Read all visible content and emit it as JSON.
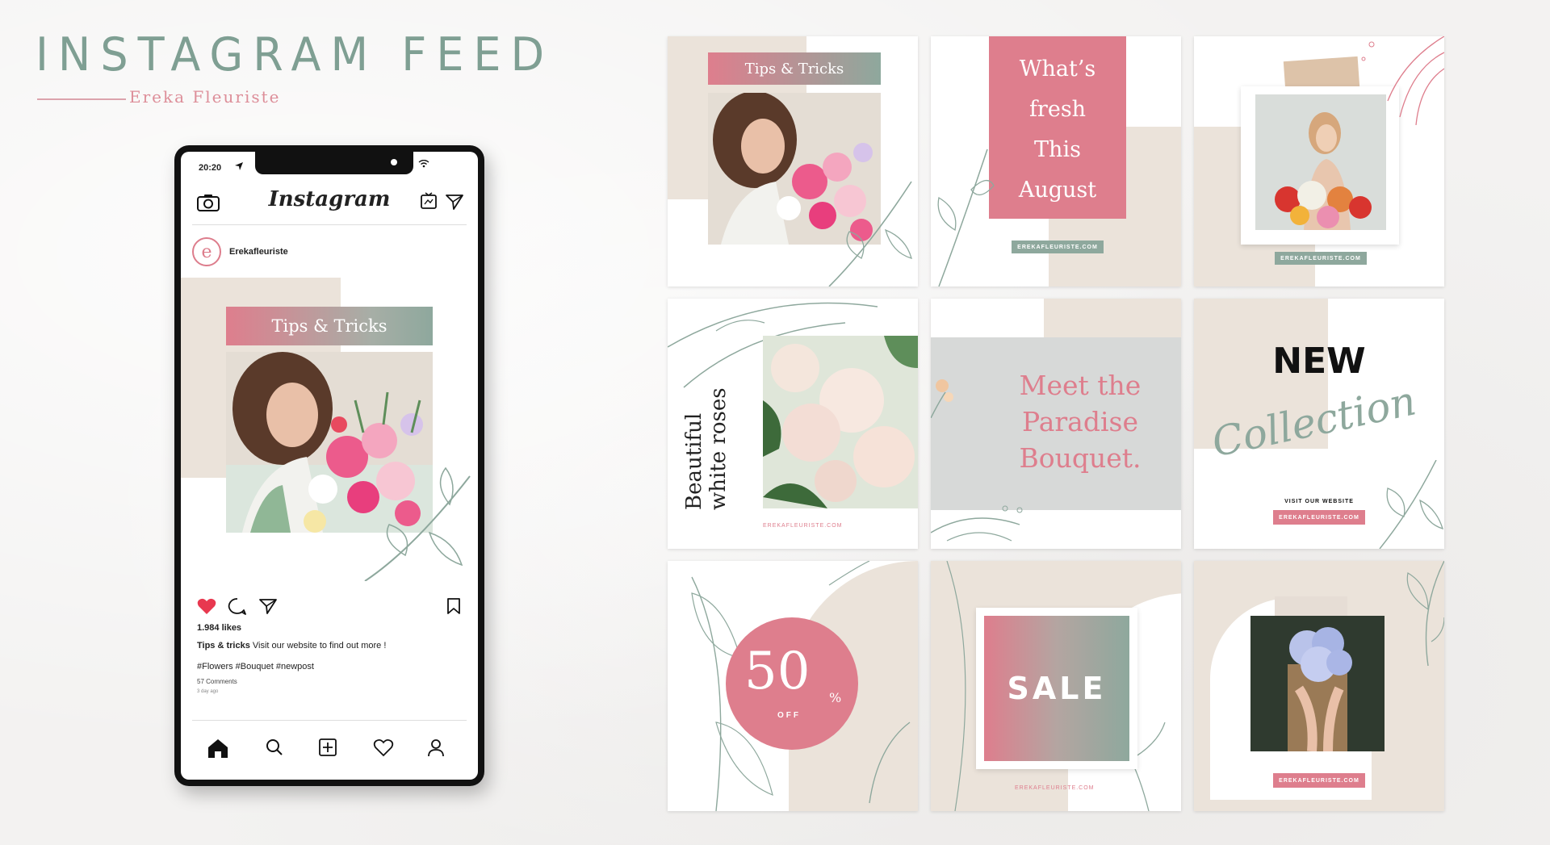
{
  "header": {
    "title": "INSTAGRAM FEED",
    "subtitle": "Ereka Fleuriste"
  },
  "phone": {
    "status_time": "20:20",
    "app_name": "Instagram",
    "username": "Erekafleuriste",
    "avatar_letter": "e",
    "post_banner": "Tips & Tricks",
    "likes": "1.984 likes",
    "caption_bold": "Tips & tricks",
    "caption_text": " Visit our website to find out more !",
    "hashtags": "#Flowers #Bouquet #newpost",
    "comments": "57 Comments",
    "time_ago": "3 day ago"
  },
  "grid": {
    "t1_banner": "Tips & Tricks",
    "t2_lines": [
      "What’s",
      "fresh",
      "This",
      "August"
    ],
    "t2_url": "EREKAFLEURISTE.COM",
    "t3_url": "EREKAFLEURISTE.COM",
    "t4_text_line1": "Beautiful",
    "t4_text_line2": "white roses",
    "t4_url": "EREKAFLEURISTE.COM",
    "t5_lines": [
      "Meet the",
      "Paradise",
      "Bouquet."
    ],
    "t6_new": "NEW",
    "t6_script": "Collection",
    "t6_visit": "VISIT OUR WEBSITE",
    "t6_url": "EREKAFLEURISTE.COM",
    "t7_number": "50",
    "t7_percent": "%",
    "t7_off": "OFF",
    "t8_sale": "SALE",
    "t8_url": "EREKAFLEURISTE.COM",
    "t9_url": "EREKAFLEURISTE.COM"
  },
  "colors": {
    "sage": "#8ea89d",
    "pink": "#de7e8d",
    "beige": "#ebe3da",
    "title": "#7f9f93"
  }
}
